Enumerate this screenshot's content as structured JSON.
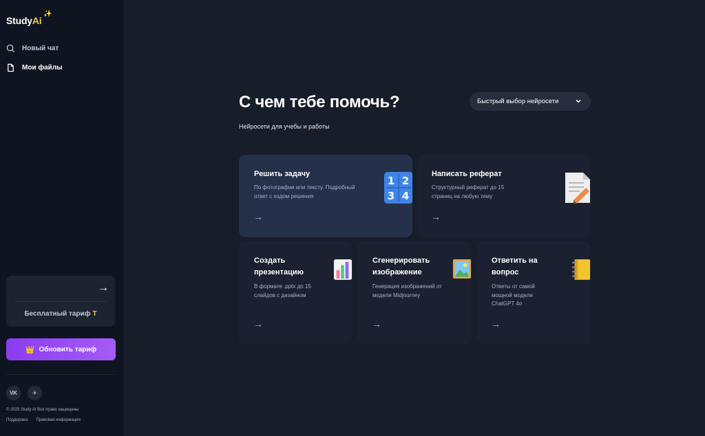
{
  "sidebar": {
    "logo_text": "Study",
    "logo_ai": "Ai",
    "logo_spark": "✨",
    "nav": [
      {
        "label": "Новый чат",
        "icon": "search-icon"
      },
      {
        "label": "Мои файлы",
        "icon": "file-icon"
      }
    ],
    "plan_arrow": "→",
    "plan_label": "Бесплатный тариф",
    "plan_badge": "T",
    "upgrade_label": "Обновить тариф",
    "upgrade_icon": "👑",
    "socials": [
      {
        "label": "VK",
        "icon": "vk-icon"
      },
      {
        "label": "✈",
        "icon": "telegram-icon"
      }
    ],
    "copyright": "© 2025 Study AI Все права защищены",
    "links": [
      "Поддержка",
      "Правовая информация"
    ]
  },
  "main": {
    "title": "С чем тебе помочь?",
    "subtitle": "Нейросети для учебы и работы",
    "model_select": "Быстрый выбор нейросети"
  },
  "cards": [
    {
      "title": "Решить задачу",
      "desc": "По фотографии или тексту. Подробный ответ с ходом решения",
      "arrow": "→",
      "icon": "numbers-1234-icon"
    },
    {
      "title": "Написать реферат",
      "desc": "Структурный реферат до 15 страниц на любую тему",
      "arrow": "→",
      "icon": "document-pencil-icon"
    },
    {
      "title": "Создать презентацию",
      "desc": "В формате .pptx до 15 слайдов с дизайном",
      "arrow": "→",
      "icon": "bar-chart-icon"
    },
    {
      "title": "Сгенерировать изображение",
      "desc": "Генерация изображений от модели Midjourney",
      "arrow": "→",
      "icon": "framed-picture-icon"
    },
    {
      "title": "Ответить на вопрос",
      "desc": "Ответы от самой мощной модели ChatGPT 4o",
      "arrow": "→",
      "icon": "notebook-icon"
    }
  ],
  "colors": {
    "background": "#171d29",
    "sidebar": "#0f1520",
    "card": "#1b2130",
    "card_active": "#25304a",
    "accent_purple": "#8a3cf0",
    "logo_gold": "#f0c84a"
  }
}
